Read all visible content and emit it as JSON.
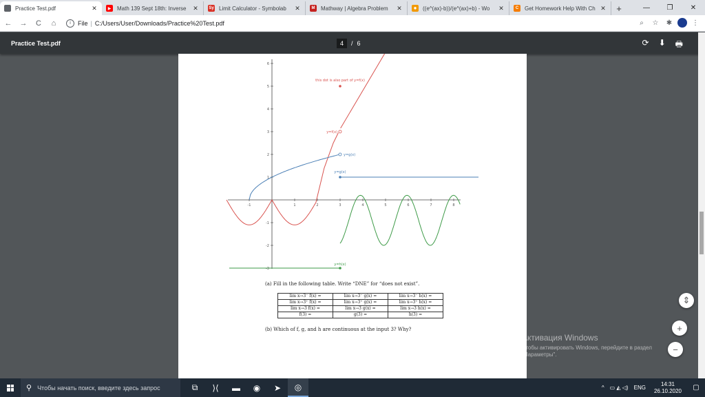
{
  "browser": {
    "tabs": [
      {
        "title": "Practice Test.pdf",
        "fav_color": "#5f6368",
        "active": true
      },
      {
        "title": "Math 139 Sept 18th: Inverse",
        "fav_color": "#ff0000",
        "active": false
      },
      {
        "title": "Limit Calculator - Symbolab",
        "fav_color": "#d93025",
        "active": false
      },
      {
        "title": "Mathway | Algebra Problem",
        "fav_color": "#c5221f",
        "active": false
      },
      {
        "title": "((e^(ax)-b))/(e^(ax)+b) - Wo",
        "fav_color": "#f29900",
        "active": false
      },
      {
        "title": "Get Homework Help With Ch",
        "fav_color": "#f57c00",
        "active": false
      }
    ],
    "tab_fav_letters": [
      "",
      "▶",
      "Sy",
      "M",
      "✹",
      "C"
    ],
    "newtab": "+",
    "window": {
      "minimize": "—",
      "maximize": "❐",
      "close": "✕"
    },
    "nav": {
      "back": "←",
      "forward": "→",
      "reload": "C",
      "home": "⌂"
    },
    "address": {
      "scheme": "File",
      "url": "C:/Users/User/Downloads/Practice%20Test.pdf"
    }
  },
  "pdf": {
    "filename": "Practice Test.pdf",
    "current_page": "4",
    "page_sep": "/",
    "total_pages": "6",
    "actions": {
      "rotate": "⟳",
      "download": "⬇",
      "print": "🖶"
    }
  },
  "graph": {
    "x_ticks": [
      "-1",
      "1",
      "2",
      "3",
      "4",
      "5",
      "6",
      "7",
      "8"
    ],
    "y_ticks": [
      "6",
      "5",
      "4",
      "3",
      "2",
      "1",
      "-1",
      "-2",
      "-3"
    ],
    "annotations": {
      "dot_note": "this dot is also part of y=f(x)",
      "f_label": "y=f(x)",
      "g_label_upper": "y=g(x)",
      "g_label_lower": "y=g(x)",
      "h_label": "y=h(x)"
    },
    "colors": {
      "f": "#d9534f",
      "g": "#4a7fb5",
      "h": "#3d9a47",
      "axis": "#444444"
    }
  },
  "question_a": "(a) Fill in the following table. Write “DNE” for “does not exist”.",
  "question_b": "(b) Which of f, g, and h are continuous at the input 3? Why?",
  "table": [
    [
      "lim x→3⁻ f(x) =",
      "lim x→3⁻ g(x) =",
      "lim x→3⁻ h(x) ="
    ],
    [
      "lim x→3⁺ f(x) =",
      "lim x→3⁺ g(x) =",
      "lim x→3⁺ h(x) ="
    ],
    [
      "lim x→3 f(x) =",
      "lim x→3 g(x) =",
      "lim x→3 h(x) ="
    ],
    [
      "f(3) =",
      "g(3) =",
      "h(3) ="
    ]
  ],
  "fabs": {
    "fit": "⇕",
    "zoom_in": "+",
    "zoom_out": "−"
  },
  "watermark": {
    "line1": "Активация Windows",
    "line2": "Чтобы активировать Windows, перейдите в раздел \"Параметры\"."
  },
  "taskbar": {
    "search_placeholder": "Чтобы начать поиск, введите здесь запрос",
    "apps": [
      "⧉",
      "⟩⟨",
      "▬",
      "◉",
      "➤",
      "◎"
    ],
    "tray": {
      "arrow": "^",
      "icons": "▭ ◭ ◁)",
      "lang": "ENG",
      "time": "14:31",
      "date": "26.10.2020",
      "notif": "▢"
    }
  }
}
